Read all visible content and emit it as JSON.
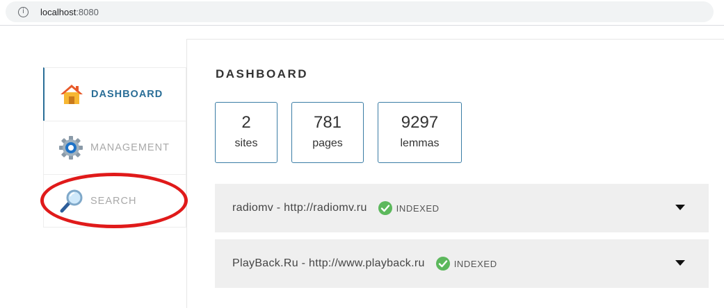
{
  "browser": {
    "url_host": "localhost",
    "url_port": ":8080",
    "info_icon": "info-icon"
  },
  "sidebar": {
    "items": [
      {
        "label": "DASHBOARD",
        "icon": "home-icon",
        "active": true
      },
      {
        "label": "MANAGEMENT",
        "icon": "gear-icon",
        "active": false
      },
      {
        "label": "SEARCH",
        "icon": "magnifier-icon",
        "active": false
      }
    ]
  },
  "annotation": {
    "shape": "ellipse",
    "color": "#e01a1a",
    "target": "SEARCH"
  },
  "main": {
    "title": "DASHBOARD",
    "stats": [
      {
        "value": "2",
        "label": "sites"
      },
      {
        "value": "781",
        "label": "pages"
      },
      {
        "value": "9297",
        "label": "lemmas"
      }
    ],
    "sites": [
      {
        "name": "radiomv - http://radiomv.ru",
        "status": "INDEXED",
        "status_icon": "check-circle-icon",
        "toggle_icon": "caret-down-icon"
      },
      {
        "name": "PlayBack.Ru - http://www.playback.ru",
        "status": "INDEXED",
        "status_icon": "check-circle-icon",
        "toggle_icon": "caret-down-icon"
      }
    ]
  },
  "colors": {
    "accent": "#2a6e97",
    "status_ok": "#5cb85c",
    "row_bg": "#efefef",
    "annotation": "#e01a1a"
  }
}
